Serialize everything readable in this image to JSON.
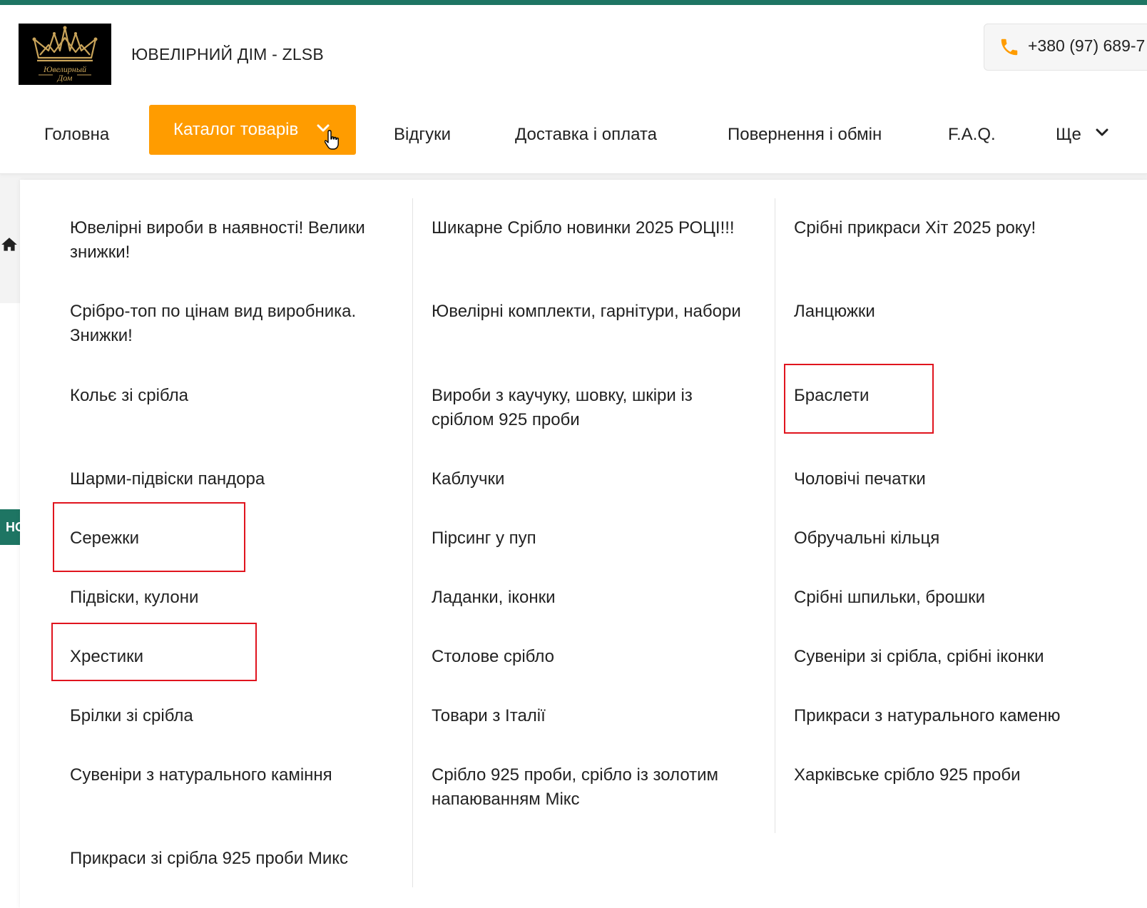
{
  "header": {
    "logo_text_line1": "Ювелирный",
    "logo_text_line2": "Дом",
    "site_title": "ЮВЕЛІРНИЙ ДІМ - ZLSB",
    "phone": "+380 (97) 689-7"
  },
  "nav": {
    "home": "Головна",
    "catalog": "Каталог товарів",
    "reviews": "Відгуки",
    "delivery": "Доставка і оплата",
    "returns": "Повернення і обмін",
    "faq": "F.A.Q.",
    "more": "Ще"
  },
  "side": {
    "tab_label": "НО"
  },
  "catalog": {
    "col1": [
      "Ювелірні вироби в наявності! Велики знижки!",
      "Срібро-топ по цінам вид виробника. Знижки!",
      "Кольє зі срібла",
      "Шарми-підвіски пандора",
      "Сережки",
      "Підвіски, кулони",
      "Хрестики",
      "Брілки зі срібла",
      "Сувеніри з натурального каміння",
      "Прикраси зі срібла 925 проби Микс"
    ],
    "col2": [
      "Шикарне Срібло новинки 2025 РОЦІ!!!",
      "Ювелірні комплекти, гарнітури, набори",
      "Вироби з каучуку, шовку, шкіри із сріблом 925 проби",
      "Каблучки",
      "Пірсинг у пуп",
      "Ладанки, іконки",
      "Столове срібло",
      "Товари з Італії",
      "Срібло 925 проби, срібло із золотим напаюванням Мікс"
    ],
    "col3": [
      "Срібні прикраси Хіт 2025 року!",
      "Ланцюжки",
      "Браслети",
      "Чоловічі печатки",
      "Обручальні кільця",
      "Срібні шпильки, брошки",
      "Сувеніри зі срібла, срібні іконки",
      "Прикраси з натурального каменю",
      "Харківське срібло 925 проби"
    ]
  },
  "colors": {
    "accent": "#ff9c00",
    "brand_green": "#1e7563",
    "highlight": "#e0141e",
    "logo_gold": "#c9a45a"
  },
  "icons": [
    "phone-icon",
    "chevron-down-icon",
    "pointer-cursor-icon",
    "home-icon",
    "crown-icon"
  ]
}
